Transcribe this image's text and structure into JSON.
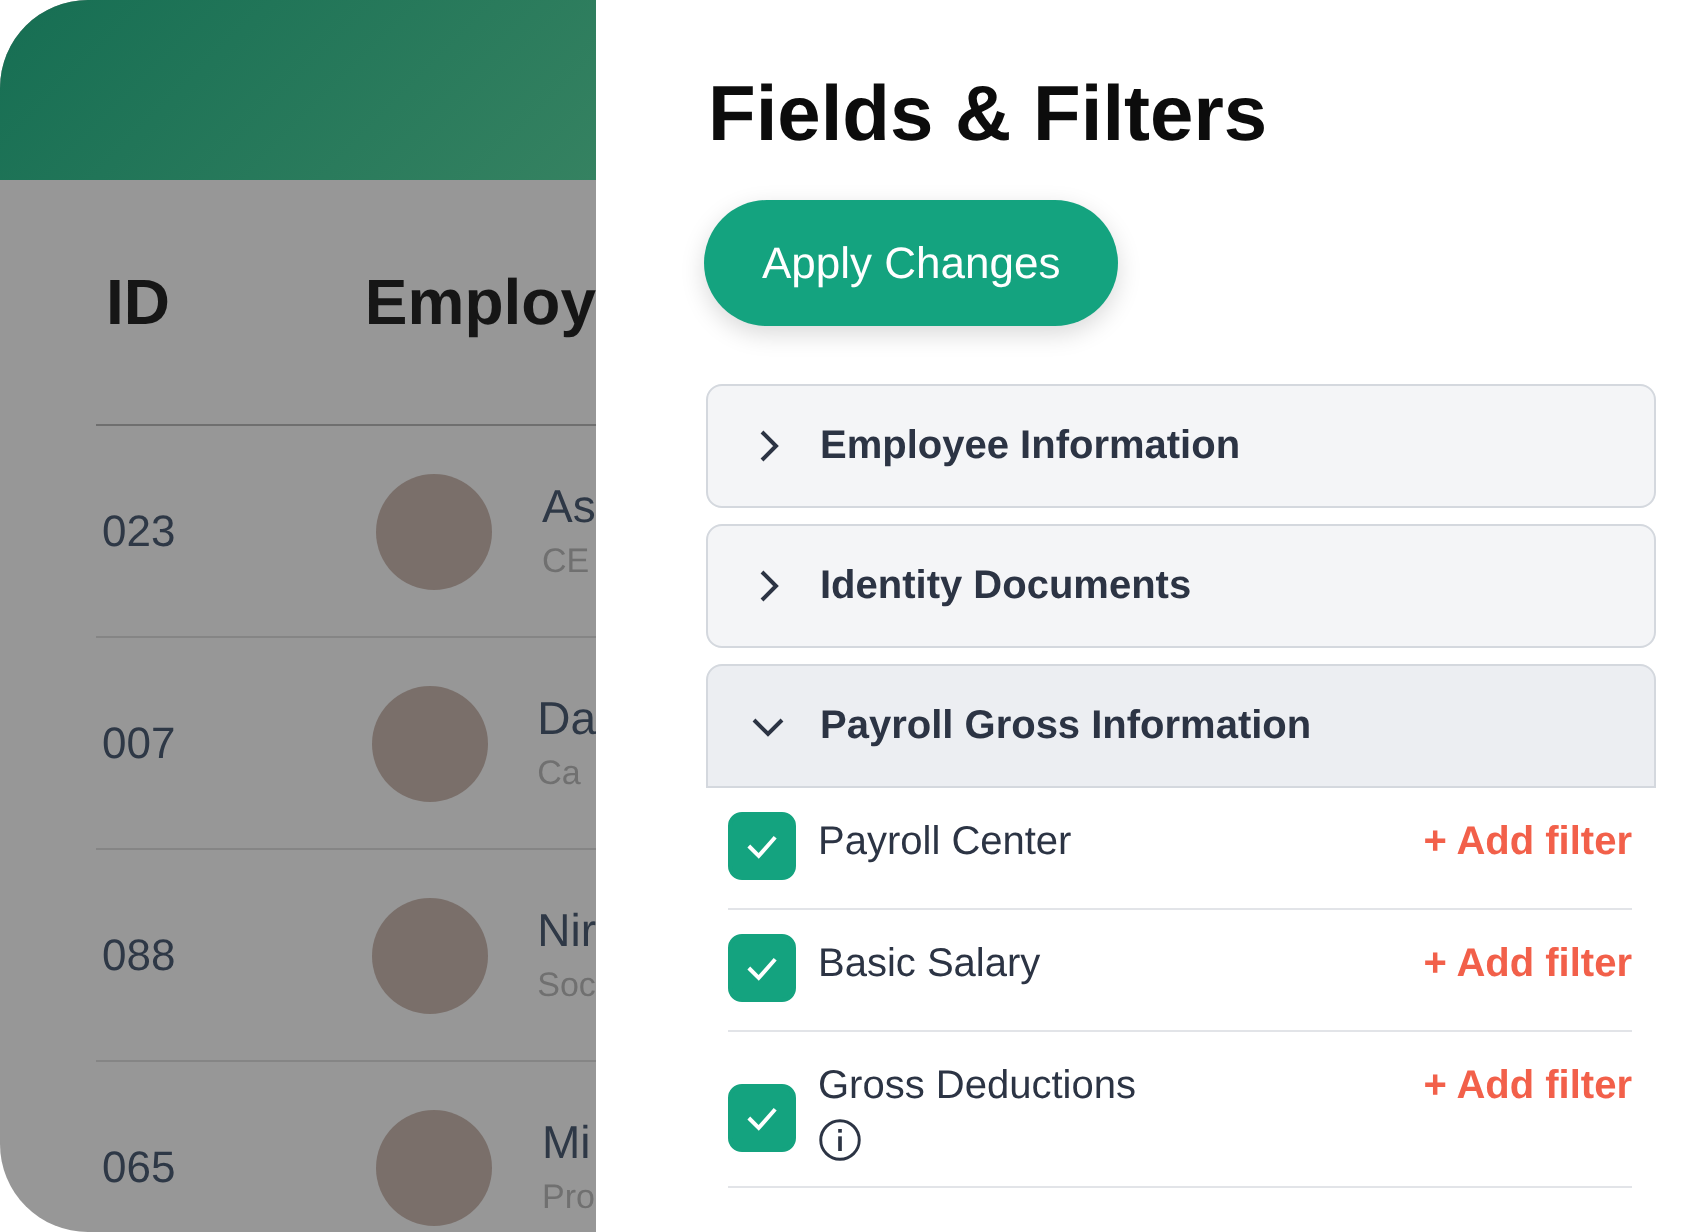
{
  "table": {
    "columns": [
      "ID",
      "Employ"
    ],
    "rows": [
      {
        "id": "023",
        "name": "As",
        "role": "CE"
      },
      {
        "id": "007",
        "name": "Da",
        "role": "Ca"
      },
      {
        "id": "088",
        "name": "Nir",
        "role": "Soc"
      },
      {
        "id": "065",
        "name": "Mi",
        "role": "Pro"
      }
    ]
  },
  "panel": {
    "title": "Fields & Filters",
    "apply_button": "Apply Changes",
    "sections": [
      {
        "title": "Employee Information",
        "expanded": false
      },
      {
        "title": "Identity Documents",
        "expanded": false
      },
      {
        "title": "Payroll Gross Information",
        "expanded": true,
        "fields": [
          {
            "label": "Payroll Center",
            "checked": true,
            "info": false,
            "action": "+ Add filter"
          },
          {
            "label": "Basic Salary",
            "checked": true,
            "info": false,
            "action": "+ Add filter"
          },
          {
            "label": "Gross Deductions",
            "checked": true,
            "info": true,
            "action": "+ Add filter"
          }
        ]
      }
    ]
  }
}
